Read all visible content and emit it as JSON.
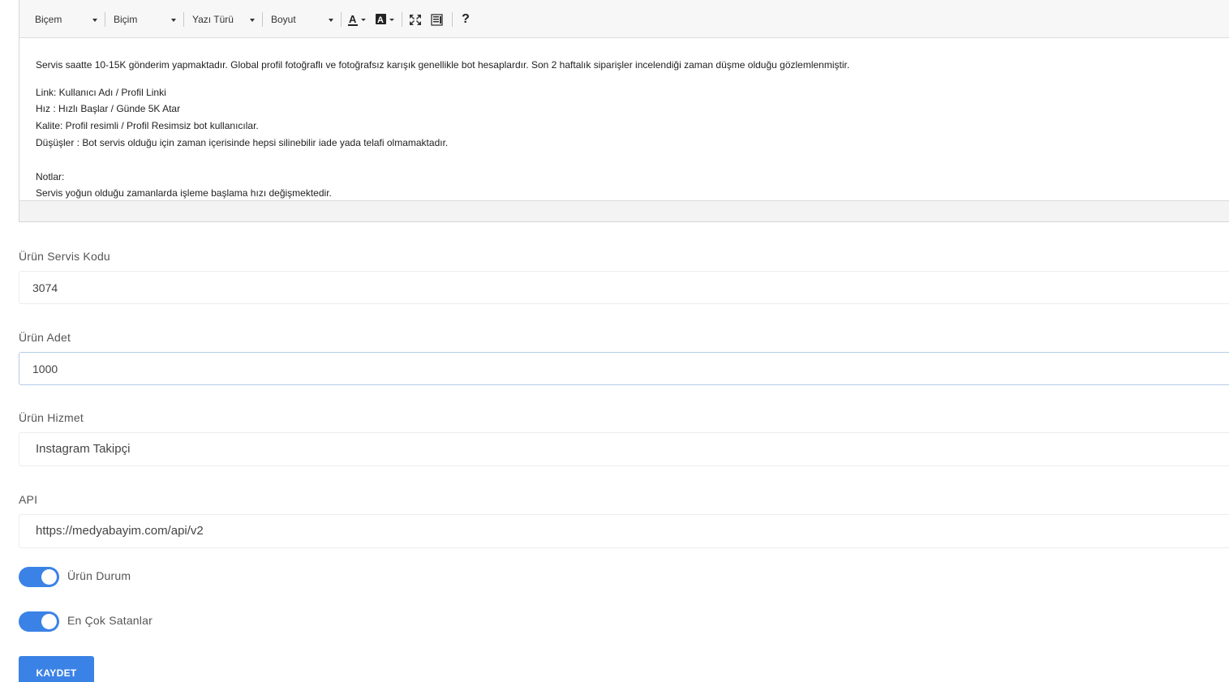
{
  "editor": {
    "toolbar": {
      "style_label": "Biçem",
      "format_label": "Biçim",
      "font_label": "Yazı Türü",
      "size_label": "Boyut",
      "help_label": "?"
    },
    "content": {
      "intro": "Servis saatte 10-15K gönderim yapmaktadır. Global profil fotoğraflı ve fotoğrafsız karışık genellikle bot hesaplardır. Son 2 haftalık siparişler incelendiği zaman düşme olduğu gözlemlenmiştir.",
      "line_link": "Link: Kullanıcı Adı / Profil Linki",
      "line_speed": "Hız : Hızlı Başlar / Günde 5K Atar",
      "line_quality": "Kalite: Profil resimli / Profil Resimsiz bot kullanıcılar.",
      "line_drops": "Düşüşler : Bot servis olduğu için zaman içerisinde hepsi silinebilir iade yada telafi olmamaktadır.",
      "notes_title": "Notlar:",
      "notes_text": "Servis yoğun olduğu zamanlarda işleme başlama hızı değişmektedir."
    }
  },
  "form": {
    "service_code": {
      "label": "Ürün Servis Kodu",
      "value": "3074"
    },
    "quantity": {
      "label": "Ürün Adet",
      "value": "1000"
    },
    "service": {
      "label": "Ürün Hizmet",
      "value": "Instagram Takipçi"
    },
    "api": {
      "label": "API",
      "value": "https://medyabayim.com/api/v2"
    },
    "status_toggle": {
      "label": "Ürün Durum",
      "on": true
    },
    "bestseller_toggle": {
      "label": "En Çok Satanlar",
      "on": true
    },
    "save_label": "KAYDET"
  },
  "colors": {
    "accent": "#3b82e6",
    "toolbar_bg": "#f7f7f7",
    "border": "#ececec"
  },
  "icons": [
    "font-color-icon",
    "background-color-icon",
    "fullscreen-icon",
    "code-view-icon",
    "help-icon"
  ]
}
